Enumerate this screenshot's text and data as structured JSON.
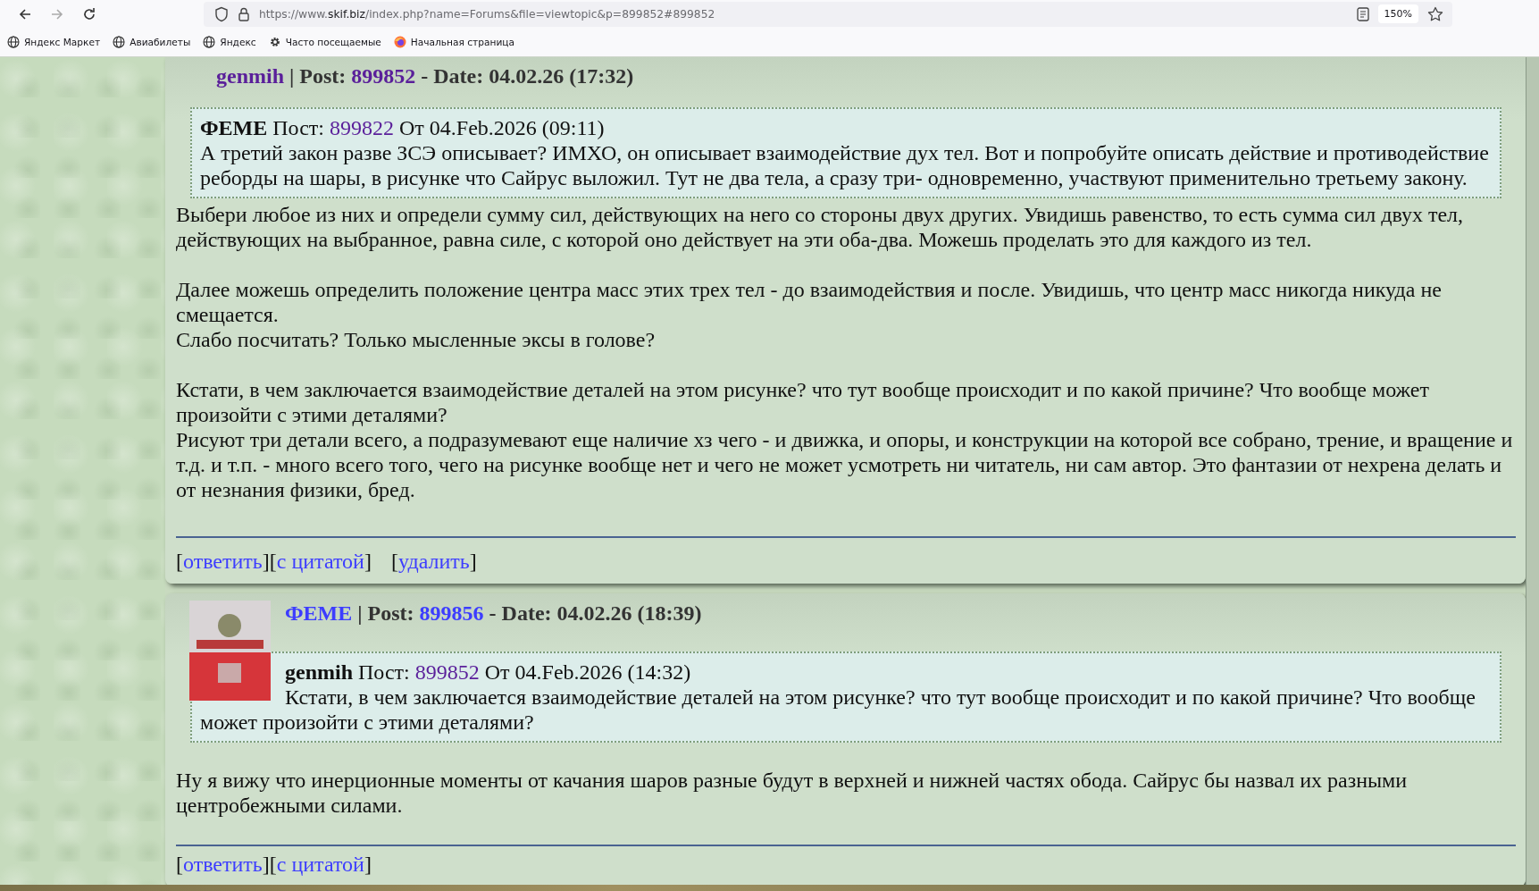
{
  "browser": {
    "nav": [
      {
        "kind": "back",
        "disabled": false
      },
      {
        "kind": "forward",
        "disabled": true
      },
      {
        "kind": "reload",
        "disabled": false
      }
    ],
    "url": {
      "prefix": "https://www.",
      "domain": "skif.biz",
      "path": "/index.php?name=Forums&file=viewtopic&p=899852#899852"
    },
    "zoom": "150%",
    "bookmarks": [
      {
        "kind": "globe",
        "label": "Яндекс Маркет"
      },
      {
        "kind": "globe",
        "label": "Авиабилеты"
      },
      {
        "kind": "globe",
        "label": "Яндекс"
      },
      {
        "kind": "gear",
        "label": "Часто посещаемые"
      },
      {
        "kind": "logo",
        "label": "Начальная страница"
      }
    ]
  },
  "posts": [
    {
      "avatar": false,
      "author": "genmih",
      "author_visited": true,
      "post_label": "| Post:",
      "post_id": "899852",
      "id_visited": true,
      "date": "- Date: 04.02.26 (17:32)",
      "quote": {
        "author": "ФЕМЕ",
        "label": "Пост:",
        "post_id": "899822",
        "id_visited": true,
        "date": "От 04.Feb.2026 (09:11)",
        "text": "А третий закон разве ЗСЭ описывает? ИМХО, он описывает взаимодействие дух тел. Вот и попробуйте описать действие и противодействие реборды на шары, в рисунке что Сайрус выложил. Тут не два тела, а сразу три- одновременно, участвуют применительно третьему закону."
      },
      "paragraphs": [
        [
          "Выбери любое из них и определи сумму сил, действующих на него со стороны двух других. Увидишь равенство, то есть сумма сил двух тел, действующих на выбранное, равна силе, с которой оно действует на эти оба-два. Можешь проделать это для каждого из тел."
        ],
        [
          "Далее можешь определить положение центра масс этих трех тел - до взаимодействия и после. Увидишь, что центр масс никогда никуда не смещается.",
          "Слабо посчитать? Только мысленные эксы в голове?"
        ],
        [
          "Кстати, в чем заключается взаимодействие деталей на этом рисунке? что тут вообще происходит и по какой причине? Что вообще может произойти с этими деталями?",
          "Рисуют три детали всего, а подразумевают еще наличие хз чего - и движка, и опоры, и конструкции на которой все собрано, трение, и вращение и т.д. и т.п. - много всего того, чего на рисунке вообще нет и чего не может усмотреть ни читатель, ни сам автор. Это фантазии от нехрена делать и от незнания физики, бред."
        ]
      ],
      "action_groups": [
        [
          {
            "open": "[",
            "label": "ответить",
            "close": "]"
          },
          {
            "open": "[",
            "label": "с цитатой",
            "close": "]"
          }
        ],
        [
          {
            "open": "[",
            "label": "удалить",
            "close": "]"
          }
        ]
      ]
    },
    {
      "avatar": true,
      "author": "ФЕМЕ",
      "author_visited": false,
      "post_label": "| Post:",
      "post_id": "899856",
      "id_visited": false,
      "date": "- Date: 04.02.26 (18:39)",
      "quote": {
        "author": "genmih",
        "label": "Пост:",
        "post_id": "899852",
        "id_visited": true,
        "date": "От 04.Feb.2026 (14:32)",
        "text": "Кстати, в чем заключается взаимодействие деталей на этом рисунке? что тут вообще происходит и по какой причине? Что вообще может произойти с этими деталями?"
      },
      "paragraphs": [
        [
          "Ну я вижу что инерционные моменты от качания шаров разные будут в верхней и нижней частях обода. Сайрус бы назвал их разными центробежными силами."
        ]
      ],
      "action_groups": [
        [
          {
            "open": "[",
            "label": "ответить",
            "close": "]"
          },
          {
            "open": "[",
            "label": "с цитатой",
            "close": "]"
          }
        ]
      ]
    }
  ]
}
